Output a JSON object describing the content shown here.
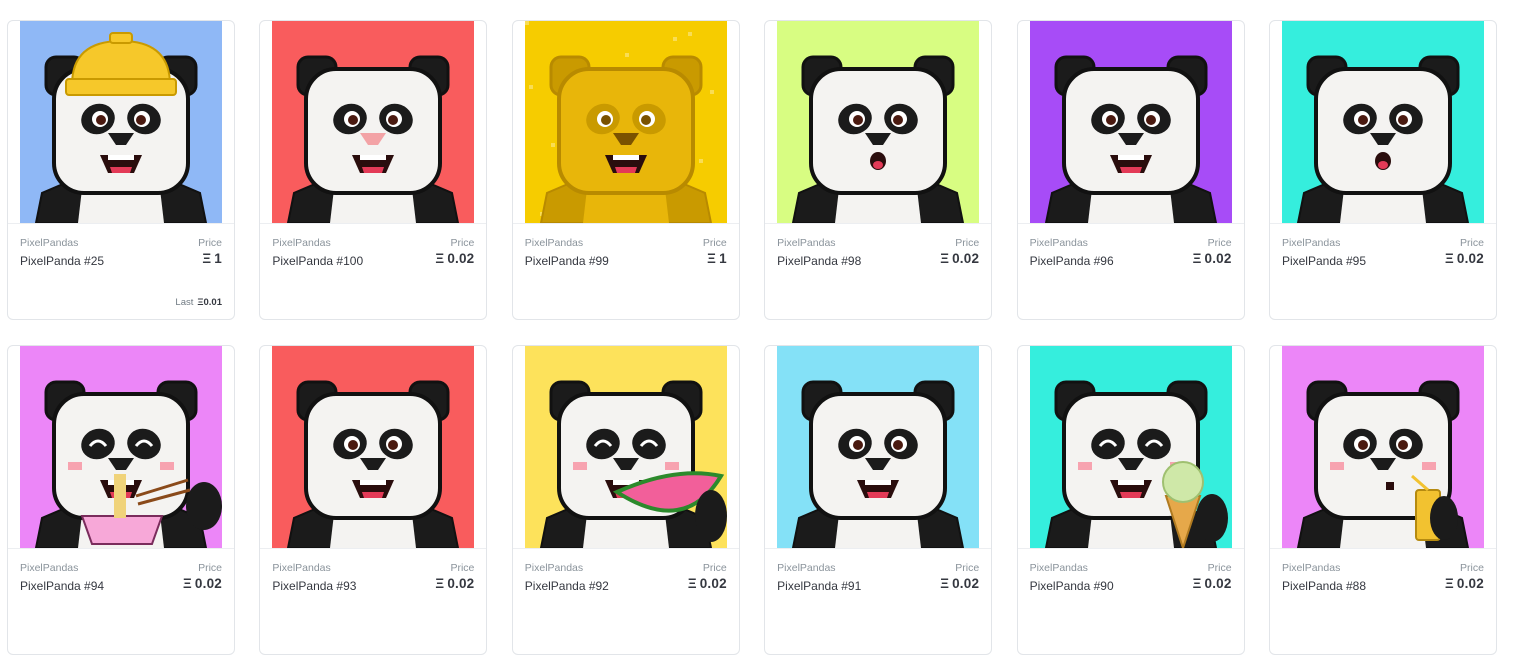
{
  "eth_symbol": "Ξ",
  "last_label": "Last",
  "price_label": "Price",
  "cards": [
    {
      "collection": "PixelPandas",
      "name": "PixelPanda #25",
      "price": "1",
      "last": "0.01",
      "bg": "#8fb8f6",
      "variant": "hat"
    },
    {
      "collection": "PixelPandas",
      "name": "PixelPanda #100",
      "price": "0.02",
      "bg": "#f95c5d",
      "variant": "pink-nose"
    },
    {
      "collection": "PixelPandas",
      "name": "PixelPanda #99",
      "price": "1",
      "bg": "#f6cc00",
      "variant": "gold"
    },
    {
      "collection": "PixelPandas",
      "name": "PixelPanda #98",
      "price": "0.02",
      "bg": "#d8fd82",
      "variant": "surprised"
    },
    {
      "collection": "PixelPandas",
      "name": "PixelPanda #96",
      "price": "0.02",
      "bg": "#a74cf7",
      "variant": "smile"
    },
    {
      "collection": "PixelPandas",
      "name": "PixelPanda #95",
      "price": "0.02",
      "bg": "#35eedd",
      "variant": "surprised"
    },
    {
      "collection": "PixelPandas",
      "name": "PixelPanda #94",
      "price": "0.02",
      "bg": "#ec86f8",
      "variant": "noodles"
    },
    {
      "collection": "PixelPandas",
      "name": "PixelPanda #93",
      "price": "0.02",
      "bg": "#f95c5d",
      "variant": "grin"
    },
    {
      "collection": "PixelPandas",
      "name": "PixelPanda #92",
      "price": "0.02",
      "bg": "#fde25b",
      "variant": "watermelon"
    },
    {
      "collection": "PixelPandas",
      "name": "PixelPanda #91",
      "price": "0.02",
      "bg": "#84e1f7",
      "variant": "smile"
    },
    {
      "collection": "PixelPandas",
      "name": "PixelPanda #90",
      "price": "0.02",
      "bg": "#35eedd",
      "variant": "icecream"
    },
    {
      "collection": "PixelPandas",
      "name": "PixelPanda #88",
      "price": "0.02",
      "bg": "#ec86f8",
      "variant": "juice"
    }
  ]
}
